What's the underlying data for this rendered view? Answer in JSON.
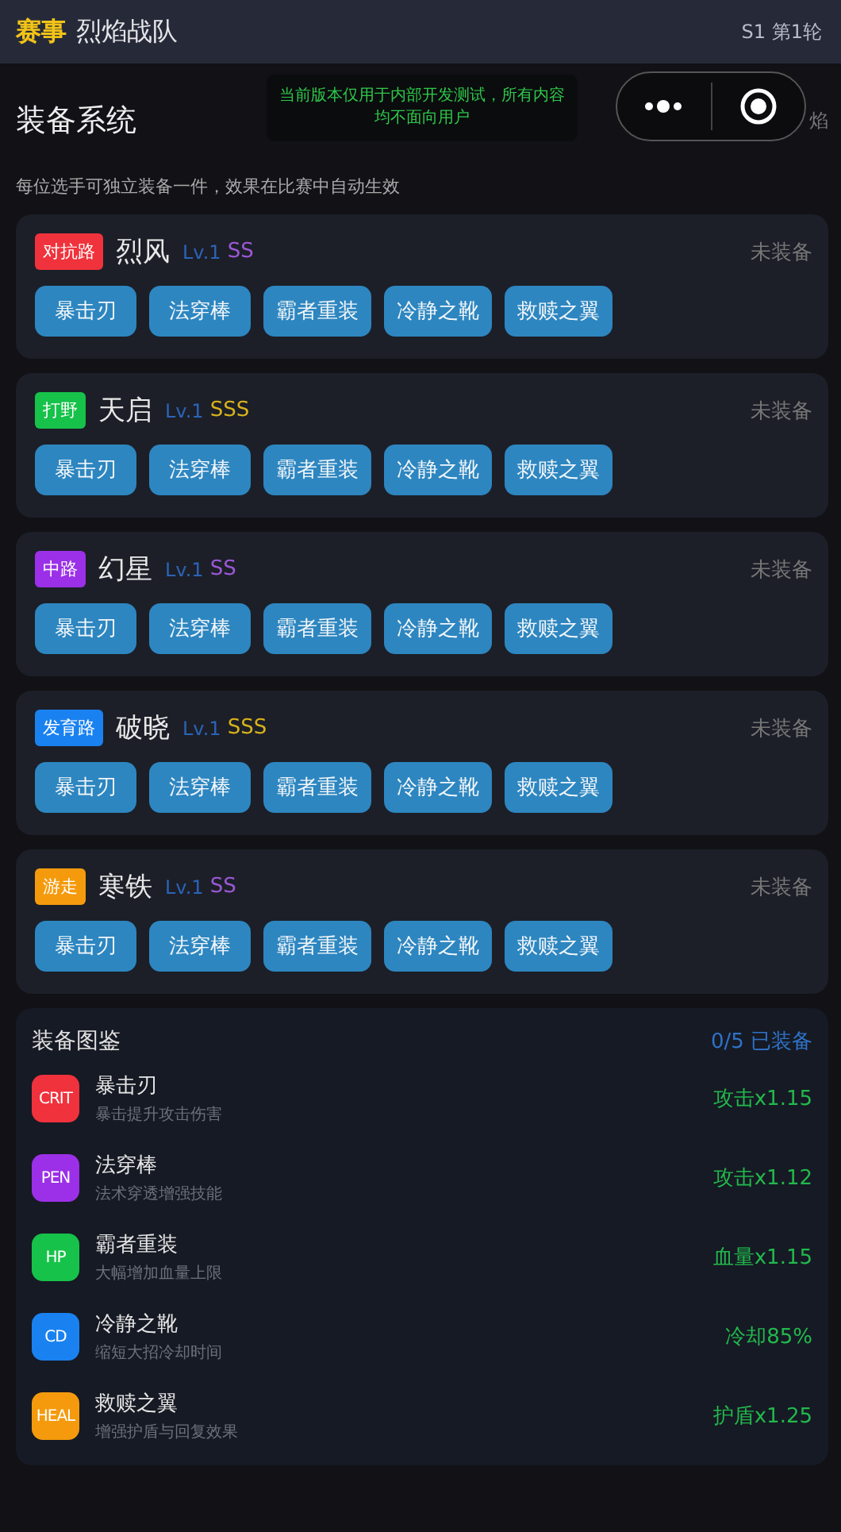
{
  "header": {
    "tag": "赛事",
    "team": "烈焰战队",
    "round": "S1 第1轮"
  },
  "dev_notice": "当前版本仅用于内部开发测试，所有内容均不面向用户",
  "page": {
    "title": "装备系统",
    "behind_capsule": "焰",
    "subtitle": "每位选手可独立装备一件，效果在比赛中自动生效"
  },
  "players": [
    {
      "role": "对抗路",
      "color": "#f0323c",
      "name": "烈风",
      "level": "Lv.1",
      "grade": "SS",
      "kind": "ss",
      "status": "未装备",
      "items": [
        "暴击刃",
        "法穿棒",
        "霸者重装",
        "冷静之靴",
        "救赎之翼"
      ]
    },
    {
      "role": "打野",
      "color": "#17c24a",
      "name": "天启",
      "level": "Lv.1",
      "grade": "SSS",
      "kind": "sss",
      "status": "未装备",
      "items": [
        "暴击刃",
        "法穿棒",
        "霸者重装",
        "冷静之靴",
        "救赎之翼"
      ]
    },
    {
      "role": "中路",
      "color": "#9b30e8",
      "name": "幻星",
      "level": "Lv.1",
      "grade": "SS",
      "kind": "ss",
      "status": "未装备",
      "items": [
        "暴击刃",
        "法穿棒",
        "霸者重装",
        "冷静之靴",
        "救赎之翼"
      ]
    },
    {
      "role": "发育路",
      "color": "#1a82f0",
      "name": "破晓",
      "level": "Lv.1",
      "grade": "SSS",
      "kind": "sss",
      "status": "未装备",
      "items": [
        "暴击刃",
        "法穿棒",
        "霸者重装",
        "冷静之靴",
        "救赎之翼"
      ]
    },
    {
      "role": "游走",
      "color": "#f59a0c",
      "name": "寒铁",
      "level": "Lv.1",
      "grade": "SS",
      "kind": "ss",
      "status": "未装备",
      "items": [
        "暴击刃",
        "法穿棒",
        "霸者重装",
        "冷静之靴",
        "救赎之翼"
      ]
    }
  ],
  "catalog": {
    "title": "装备图鉴",
    "count": "0/5 已装备",
    "entries": [
      {
        "code": "CRIT",
        "color": "#f0323c",
        "name": "暴击刃",
        "desc": "暴击提升攻击伤害",
        "effect": "攻击x1.15"
      },
      {
        "code": "PEN",
        "color": "#9b30e8",
        "name": "法穿棒",
        "desc": "法术穿透增强技能",
        "effect": "攻击x1.12"
      },
      {
        "code": "HP",
        "color": "#17c24a",
        "name": "霸者重装",
        "desc": "大幅增加血量上限",
        "effect": "血量x1.15"
      },
      {
        "code": "CD",
        "color": "#1a82f0",
        "name": "冷静之靴",
        "desc": "缩短大招冷却时间",
        "effect": "冷却85%"
      },
      {
        "code": "HEAL",
        "color": "#f59a0c",
        "name": "救赎之翼",
        "desc": "增强护盾与回复效果",
        "effect": "护盾x1.25"
      }
    ]
  }
}
